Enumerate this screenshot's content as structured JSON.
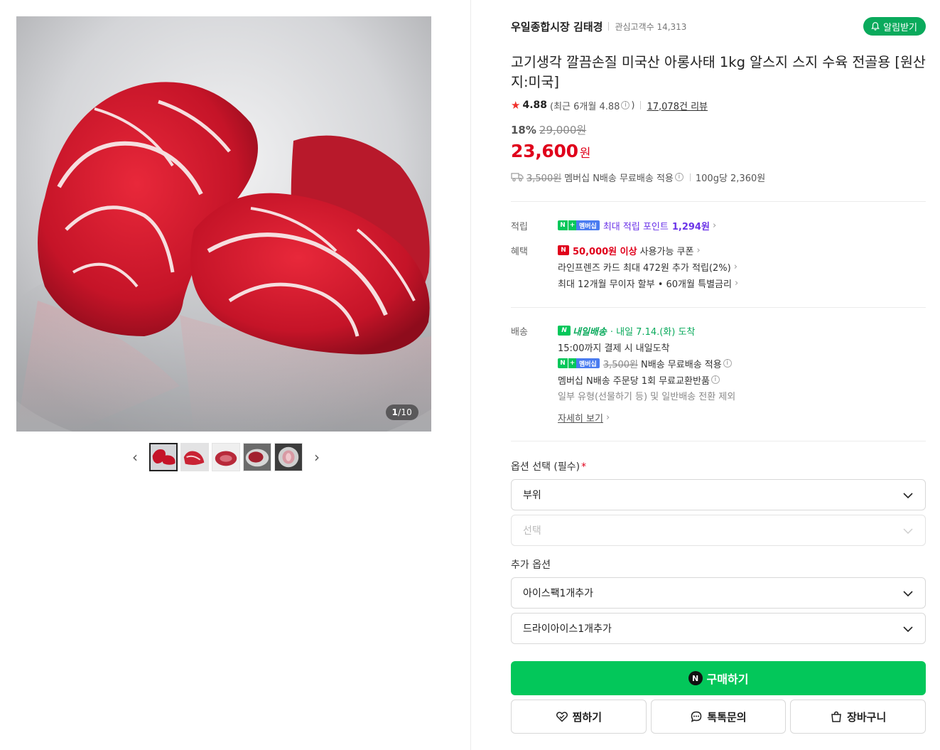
{
  "gallery": {
    "counter_current": "1",
    "counter_total": "10",
    "counter_sep": "/",
    "thumbnails": 5
  },
  "store": {
    "name": "우일종합시장 김태경",
    "fans": "관심고객수 14,313",
    "notify_label": "알림받기"
  },
  "product": {
    "title": "고기생각 깔끔손질 미국산 아롱사태 1kg 알스지 스지 수육 전골용 [원산지:미국]",
    "rating": "4.88",
    "rating_recent": "(최근 6개월 4.88",
    "rating_recent_close": ")",
    "reviews": "17,078건 리뷰",
    "discount_rate": "18%",
    "original_price": "29,000원",
    "price": "23,600",
    "price_unit": "원",
    "shipping_fee": "3,500원",
    "shipping_text": "멤버십 N배송 무료배송 적용",
    "unit_price": "100g당 2,360원"
  },
  "benefits": {
    "points_label": "적립",
    "points_badge_n": "N",
    "points_badge_mem": "멤버십",
    "points_text": "최대 적립 포인트",
    "points_value": "1,294원",
    "perks_label": "혜택",
    "coupon_badge": "N",
    "coupon_amount": "50,000원 이상",
    "coupon_text": "사용가능 쿠폰",
    "card_text": "라인프렌즈 카드 최대 472원 추가 적립(2%)",
    "installment_text": "최대 12개월 무이자 할부 • 60개월 특별금리"
  },
  "delivery": {
    "label": "배송",
    "badge": "N",
    "next_day": "내일배송",
    "arrival": "· 내일 7.14.(화) 도착",
    "cutoff": "15:00까지 결제 시 내일도착",
    "free_fee": "3,500원",
    "free_text": "N배송 무료배송 적용",
    "exchange_text": "멤버십 N배송 주문당 1회 무료교환반품",
    "exclusion_text": "일부 유형(선물하기 등) 및 일반배송 전환 제외",
    "detail_link": "자세히 보기"
  },
  "options": {
    "required_label": "옵션 선택 (필수)",
    "required_mark": "*",
    "select_part": "부위",
    "select_choice_placeholder": "선택",
    "extra_label": "추가 옵션",
    "extra_1": "아이스팩1개추가",
    "extra_2": "드라이아이스1개추가"
  },
  "actions": {
    "buy_badge": "N",
    "buy": "구매하기",
    "wish": "찜하기",
    "talk": "톡톡문의",
    "cart": "장바구니"
  },
  "colors": {
    "brand_green": "#03c75a",
    "price_red": "#e0001b",
    "points_purple": "#6b34e8"
  }
}
